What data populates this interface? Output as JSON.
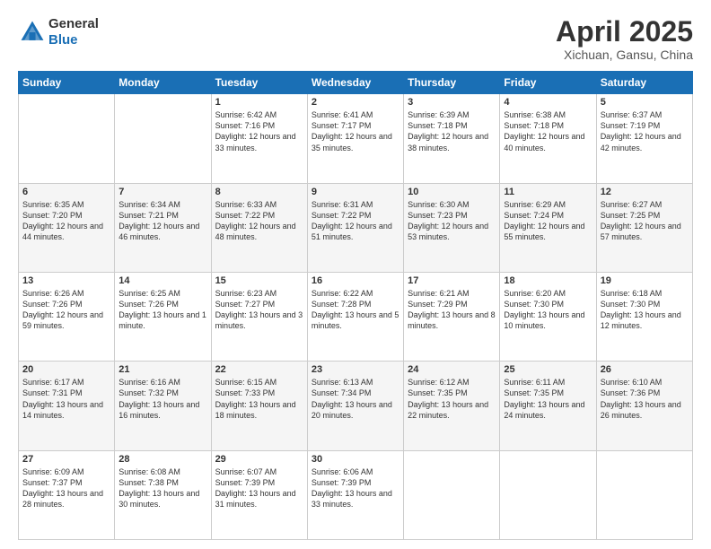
{
  "header": {
    "logo_line1": "General",
    "logo_line2": "Blue",
    "month": "April 2025",
    "location": "Xichuan, Gansu, China"
  },
  "weekdays": [
    "Sunday",
    "Monday",
    "Tuesday",
    "Wednesday",
    "Thursday",
    "Friday",
    "Saturday"
  ],
  "weeks": [
    [
      {
        "day": "",
        "info": ""
      },
      {
        "day": "",
        "info": ""
      },
      {
        "day": "1",
        "info": "Sunrise: 6:42 AM\nSunset: 7:16 PM\nDaylight: 12 hours and 33 minutes."
      },
      {
        "day": "2",
        "info": "Sunrise: 6:41 AM\nSunset: 7:17 PM\nDaylight: 12 hours and 35 minutes."
      },
      {
        "day": "3",
        "info": "Sunrise: 6:39 AM\nSunset: 7:18 PM\nDaylight: 12 hours and 38 minutes."
      },
      {
        "day": "4",
        "info": "Sunrise: 6:38 AM\nSunset: 7:18 PM\nDaylight: 12 hours and 40 minutes."
      },
      {
        "day": "5",
        "info": "Sunrise: 6:37 AM\nSunset: 7:19 PM\nDaylight: 12 hours and 42 minutes."
      }
    ],
    [
      {
        "day": "6",
        "info": "Sunrise: 6:35 AM\nSunset: 7:20 PM\nDaylight: 12 hours and 44 minutes."
      },
      {
        "day": "7",
        "info": "Sunrise: 6:34 AM\nSunset: 7:21 PM\nDaylight: 12 hours and 46 minutes."
      },
      {
        "day": "8",
        "info": "Sunrise: 6:33 AM\nSunset: 7:22 PM\nDaylight: 12 hours and 48 minutes."
      },
      {
        "day": "9",
        "info": "Sunrise: 6:31 AM\nSunset: 7:22 PM\nDaylight: 12 hours and 51 minutes."
      },
      {
        "day": "10",
        "info": "Sunrise: 6:30 AM\nSunset: 7:23 PM\nDaylight: 12 hours and 53 minutes."
      },
      {
        "day": "11",
        "info": "Sunrise: 6:29 AM\nSunset: 7:24 PM\nDaylight: 12 hours and 55 minutes."
      },
      {
        "day": "12",
        "info": "Sunrise: 6:27 AM\nSunset: 7:25 PM\nDaylight: 12 hours and 57 minutes."
      }
    ],
    [
      {
        "day": "13",
        "info": "Sunrise: 6:26 AM\nSunset: 7:26 PM\nDaylight: 12 hours and 59 minutes."
      },
      {
        "day": "14",
        "info": "Sunrise: 6:25 AM\nSunset: 7:26 PM\nDaylight: 13 hours and 1 minute."
      },
      {
        "day": "15",
        "info": "Sunrise: 6:23 AM\nSunset: 7:27 PM\nDaylight: 13 hours and 3 minutes."
      },
      {
        "day": "16",
        "info": "Sunrise: 6:22 AM\nSunset: 7:28 PM\nDaylight: 13 hours and 5 minutes."
      },
      {
        "day": "17",
        "info": "Sunrise: 6:21 AM\nSunset: 7:29 PM\nDaylight: 13 hours and 8 minutes."
      },
      {
        "day": "18",
        "info": "Sunrise: 6:20 AM\nSunset: 7:30 PM\nDaylight: 13 hours and 10 minutes."
      },
      {
        "day": "19",
        "info": "Sunrise: 6:18 AM\nSunset: 7:30 PM\nDaylight: 13 hours and 12 minutes."
      }
    ],
    [
      {
        "day": "20",
        "info": "Sunrise: 6:17 AM\nSunset: 7:31 PM\nDaylight: 13 hours and 14 minutes."
      },
      {
        "day": "21",
        "info": "Sunrise: 6:16 AM\nSunset: 7:32 PM\nDaylight: 13 hours and 16 minutes."
      },
      {
        "day": "22",
        "info": "Sunrise: 6:15 AM\nSunset: 7:33 PM\nDaylight: 13 hours and 18 minutes."
      },
      {
        "day": "23",
        "info": "Sunrise: 6:13 AM\nSunset: 7:34 PM\nDaylight: 13 hours and 20 minutes."
      },
      {
        "day": "24",
        "info": "Sunrise: 6:12 AM\nSunset: 7:35 PM\nDaylight: 13 hours and 22 minutes."
      },
      {
        "day": "25",
        "info": "Sunrise: 6:11 AM\nSunset: 7:35 PM\nDaylight: 13 hours and 24 minutes."
      },
      {
        "day": "26",
        "info": "Sunrise: 6:10 AM\nSunset: 7:36 PM\nDaylight: 13 hours and 26 minutes."
      }
    ],
    [
      {
        "day": "27",
        "info": "Sunrise: 6:09 AM\nSunset: 7:37 PM\nDaylight: 13 hours and 28 minutes."
      },
      {
        "day": "28",
        "info": "Sunrise: 6:08 AM\nSunset: 7:38 PM\nDaylight: 13 hours and 30 minutes."
      },
      {
        "day": "29",
        "info": "Sunrise: 6:07 AM\nSunset: 7:39 PM\nDaylight: 13 hours and 31 minutes."
      },
      {
        "day": "30",
        "info": "Sunrise: 6:06 AM\nSunset: 7:39 PM\nDaylight: 13 hours and 33 minutes."
      },
      {
        "day": "",
        "info": ""
      },
      {
        "day": "",
        "info": ""
      },
      {
        "day": "",
        "info": ""
      }
    ]
  ]
}
